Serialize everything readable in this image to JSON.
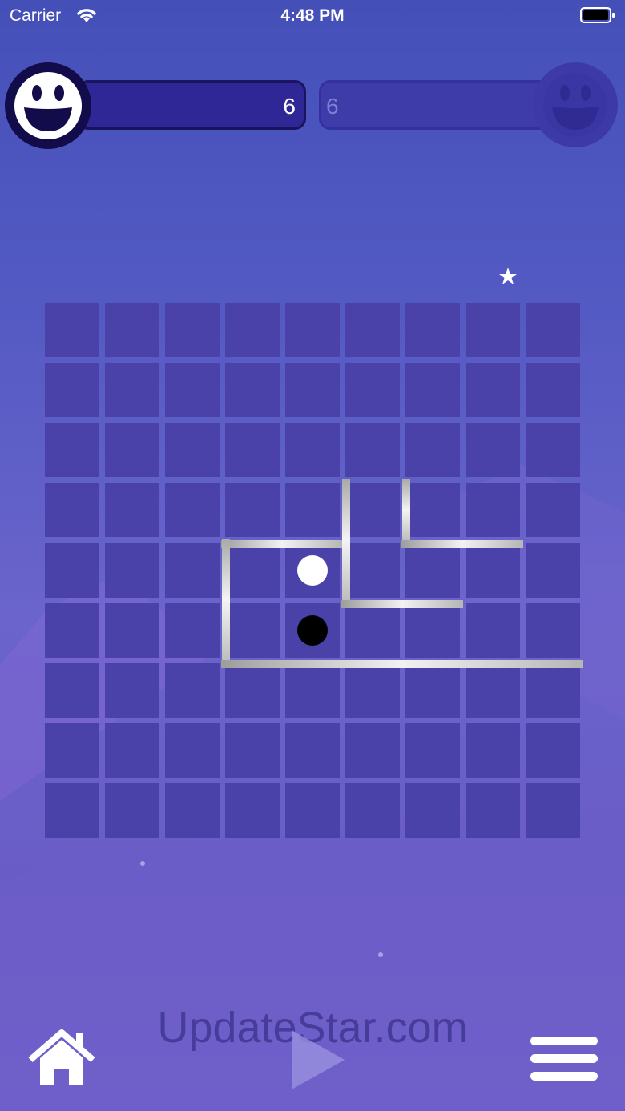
{
  "status_bar": {
    "carrier": "Carrier",
    "time": "4:48 PM"
  },
  "player1": {
    "score": "6",
    "avatar": "smiley-face-icon",
    "active": true
  },
  "player2": {
    "score": "6",
    "avatar": "smiley-face-icon",
    "active": false
  },
  "board": {
    "rows": 9,
    "cols": 9,
    "walls": [
      {
        "orientation": "h",
        "col": 3,
        "row": 4,
        "length": 2
      },
      {
        "orientation": "v",
        "col": 3,
        "row": 4,
        "length": 2
      },
      {
        "orientation": "h",
        "col": 3,
        "row": 6,
        "length": 6
      },
      {
        "orientation": "v",
        "col": 5,
        "row": 3,
        "length": 2
      },
      {
        "orientation": "h",
        "col": 5,
        "row": 5,
        "length": 2
      },
      {
        "orientation": "v",
        "col": 6,
        "row": 3,
        "length": 1
      },
      {
        "orientation": "h",
        "col": 6,
        "row": 4,
        "length": 2
      }
    ],
    "pieces": [
      {
        "color": "white",
        "col": 4,
        "row": 4
      },
      {
        "color": "black",
        "col": 4,
        "row": 5
      }
    ]
  },
  "controls": {
    "home": "home-icon",
    "play": "play-icon",
    "menu": "menu-icon"
  },
  "watermark": "UpdateStar.com",
  "colors": {
    "cell": "#4a41a9",
    "active_bar": "#2f2796",
    "inactive_bar": "#3e3ca8"
  }
}
